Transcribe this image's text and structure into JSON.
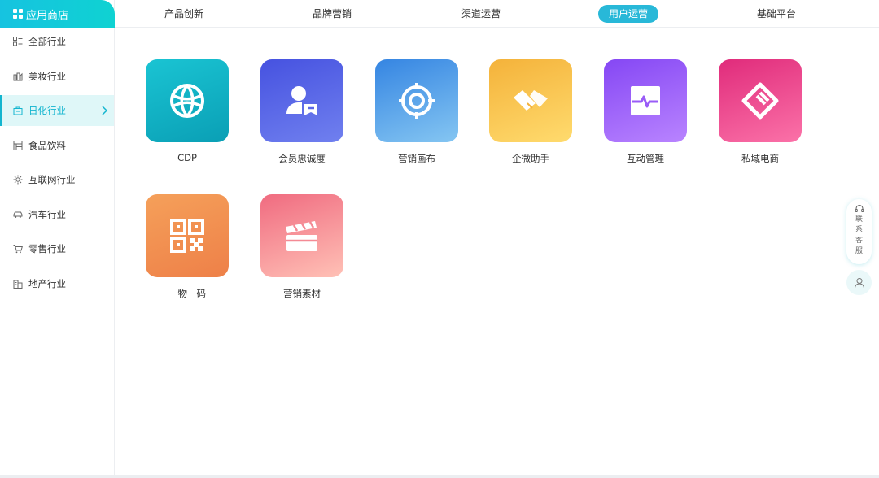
{
  "sidebar": {
    "brand": "应用商店",
    "items": [
      {
        "label": "全部行业",
        "icon": "list-icon"
      },
      {
        "label": "美妆行业",
        "icon": "cosmetics-icon"
      },
      {
        "label": "日化行业",
        "icon": "bag-icon",
        "active": true
      },
      {
        "label": "食品饮料",
        "icon": "food-icon"
      },
      {
        "label": "互联网行业",
        "icon": "network-icon"
      },
      {
        "label": "汽车行业",
        "icon": "car-icon"
      },
      {
        "label": "零售行业",
        "icon": "cart-icon"
      },
      {
        "label": "地产行业",
        "icon": "building-icon"
      }
    ]
  },
  "tabs": [
    {
      "label": "产品创新"
    },
    {
      "label": "品牌营销"
    },
    {
      "label": "渠道运营"
    },
    {
      "label": "用户运营",
      "active": true
    },
    {
      "label": "基础平台"
    }
  ],
  "apps": [
    {
      "label": "CDP",
      "icon": "globe-icon",
      "colors": [
        "#1ac4d3",
        "#0a9fb5"
      ]
    },
    {
      "label": "会员忠诚度",
      "icon": "member-icon",
      "colors": [
        "#4e5ce6",
        "#6a79ee"
      ]
    },
    {
      "label": "营销画布",
      "icon": "target-icon",
      "colors": [
        "#3a8ee6",
        "#7cc0f0"
      ]
    },
    {
      "label": "企微助手",
      "icon": "handshake-icon",
      "colors": [
        "#f6b93b",
        "#ffd768"
      ]
    },
    {
      "label": "互动管理",
      "icon": "pulse-icon",
      "colors": [
        "#8a4cf5",
        "#b27bff"
      ]
    },
    {
      "label": "私域电商",
      "icon": "tag-icon",
      "colors": [
        "#e5307f",
        "#f86aa3"
      ]
    },
    {
      "label": "一物一码",
      "icon": "qrcode-icon",
      "colors": [
        "#f08a4e",
        "#fbb06a"
      ]
    },
    {
      "label": "营销素材",
      "icon": "clapper-icon",
      "colors": [
        "#f16b7e",
        "#ffb3b0"
      ]
    }
  ],
  "float": {
    "service": "联系客服",
    "service_icon": "headset-icon",
    "user_icon": "user-icon"
  }
}
